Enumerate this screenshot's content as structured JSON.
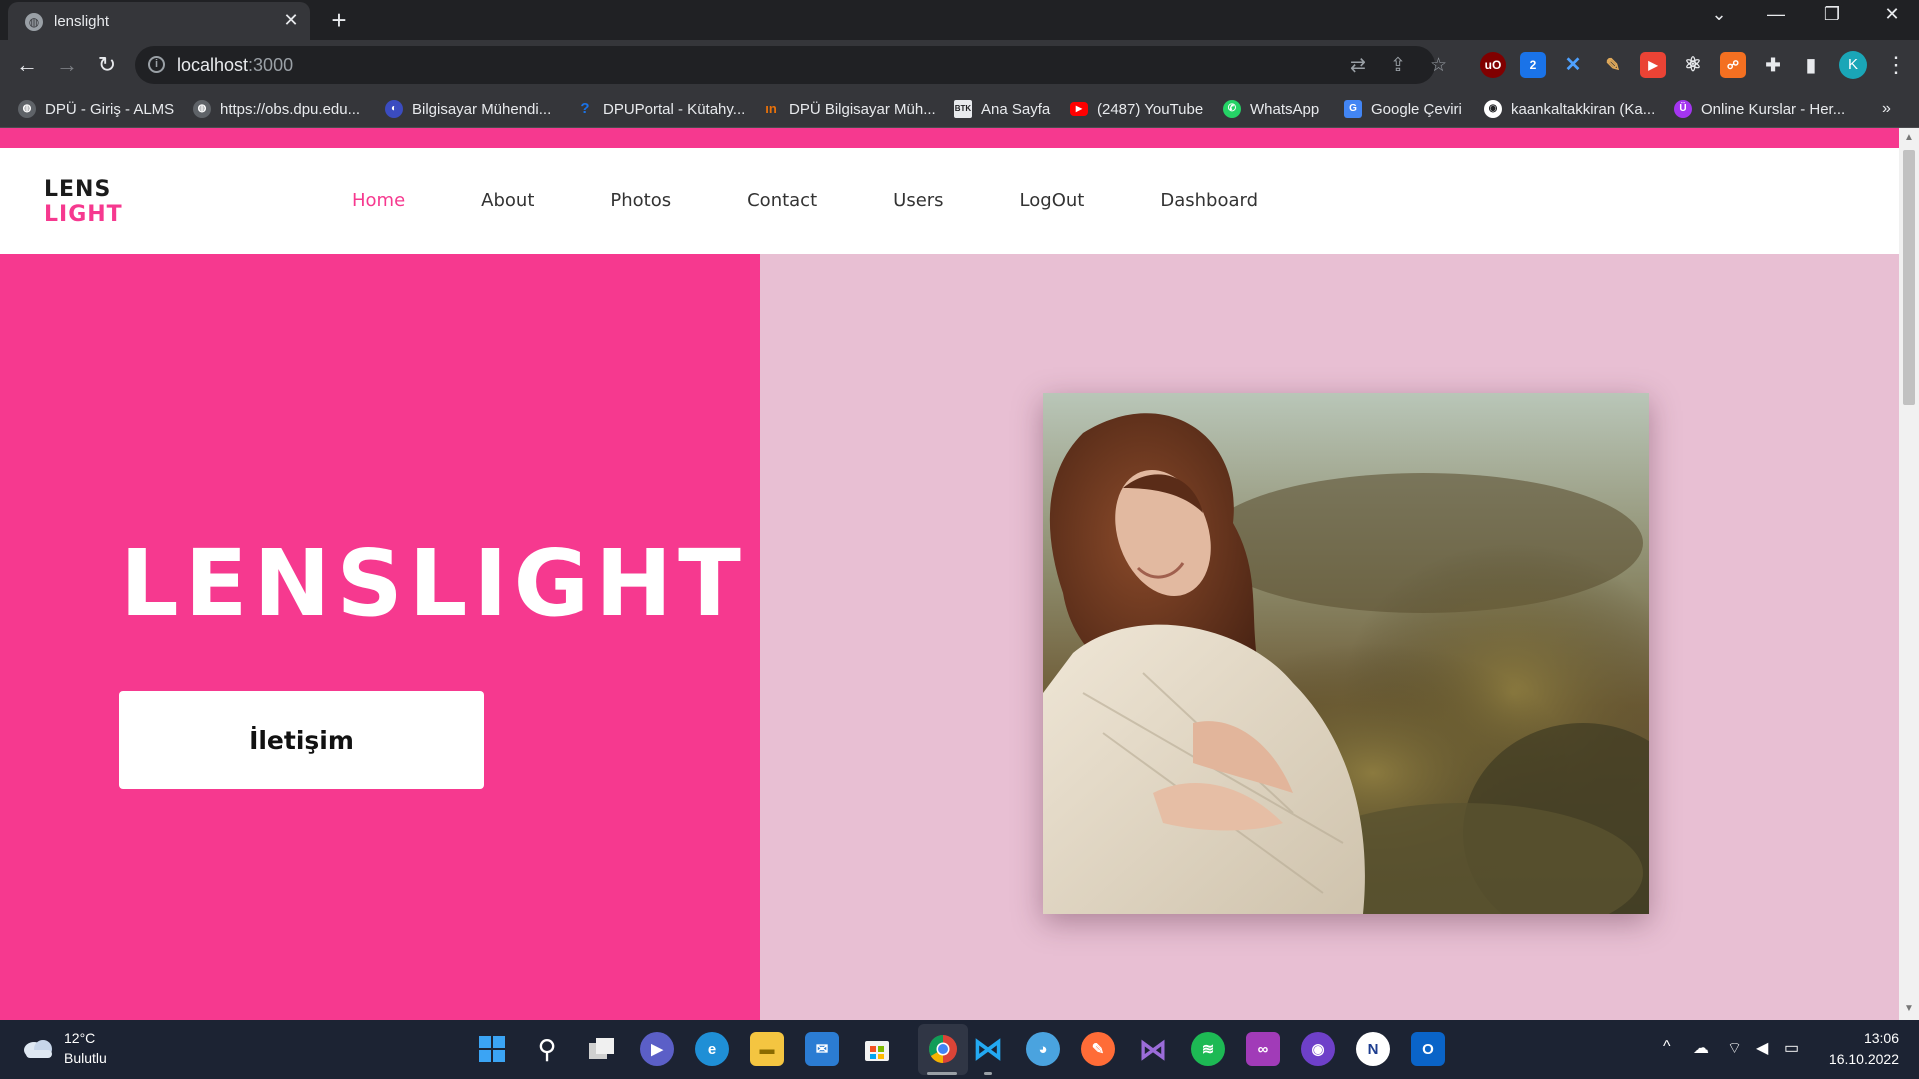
{
  "browser": {
    "tab_title": "lenslight",
    "url_host": "localhost",
    "url_port": ":3000",
    "new_tab": "+",
    "close_tab": "✕",
    "profile_initial": "K",
    "bookmarks": [
      {
        "label": "DPÜ - Giriş - ALMS",
        "icon": "globe-icon",
        "color": "#5f6368"
      },
      {
        "label": "https://obs.dpu.edu...",
        "icon": "globe-icon",
        "color": "#5f6368"
      },
      {
        "label": "Bilgisayar Mühendi...",
        "icon": "shield-icon",
        "color": "#3b4cc0"
      },
      {
        "label": "DPUPortal - Kütahy...",
        "icon": "question-icon",
        "color": "#1a73e8"
      },
      {
        "label": "DPÜ Bilgisayar Müh...",
        "icon": "dpu-logo-icon",
        "color": "#e8710a"
      },
      {
        "label": "Ana Sayfa",
        "icon": "btk-logo-icon",
        "color": "#e8eaed"
      },
      {
        "label": "(2487) YouTube",
        "icon": "youtube-icon",
        "color": "#ff0000"
      },
      {
        "label": "WhatsApp",
        "icon": "whatsapp-icon",
        "color": "#25d366"
      },
      {
        "label": "Google Çeviri",
        "icon": "google-translate-icon",
        "color": "#4285f4"
      },
      {
        "label": "kaankaltakkiran (Ka...",
        "icon": "github-icon",
        "color": "#ffffff"
      },
      {
        "label": "Online Kurslar - Her...",
        "icon": "udemy-icon",
        "color": "#a435f0"
      }
    ],
    "more_bookmarks": "»"
  },
  "site": {
    "logo_line1": "LENS",
    "logo_line2": "LIGHT",
    "nav": [
      {
        "label": "Home",
        "active": true
      },
      {
        "label": "About",
        "active": false
      },
      {
        "label": "Photos",
        "active": false
      },
      {
        "label": "Contact",
        "active": false
      },
      {
        "label": "Users",
        "active": false
      },
      {
        "label": "LogOut",
        "active": false
      },
      {
        "label": "Dashboard",
        "active": false
      }
    ],
    "hero_title": "LENSLIGHT",
    "hero_button": "İletişim",
    "accent_color": "#f6398f",
    "hero_right_bg": "#e8bfd3"
  },
  "taskbar": {
    "weather_temp": "12°C",
    "weather_desc": "Bulutlu",
    "time": "13:06",
    "date": "16.10.2022",
    "apps": [
      "windows-start-icon",
      "search-icon",
      "task-view-icon",
      "teams-chat-icon",
      "edge-icon",
      "file-explorer-icon",
      "mail-icon",
      "microsoft-store-icon",
      "chrome-icon",
      "vscode-icon",
      "paint-icon",
      "postman-icon",
      "visual-studio-icon",
      "spotify-icon",
      "arduino-icon",
      "github-desktop-icon",
      "notion-icon",
      "outlook-icon"
    ]
  }
}
